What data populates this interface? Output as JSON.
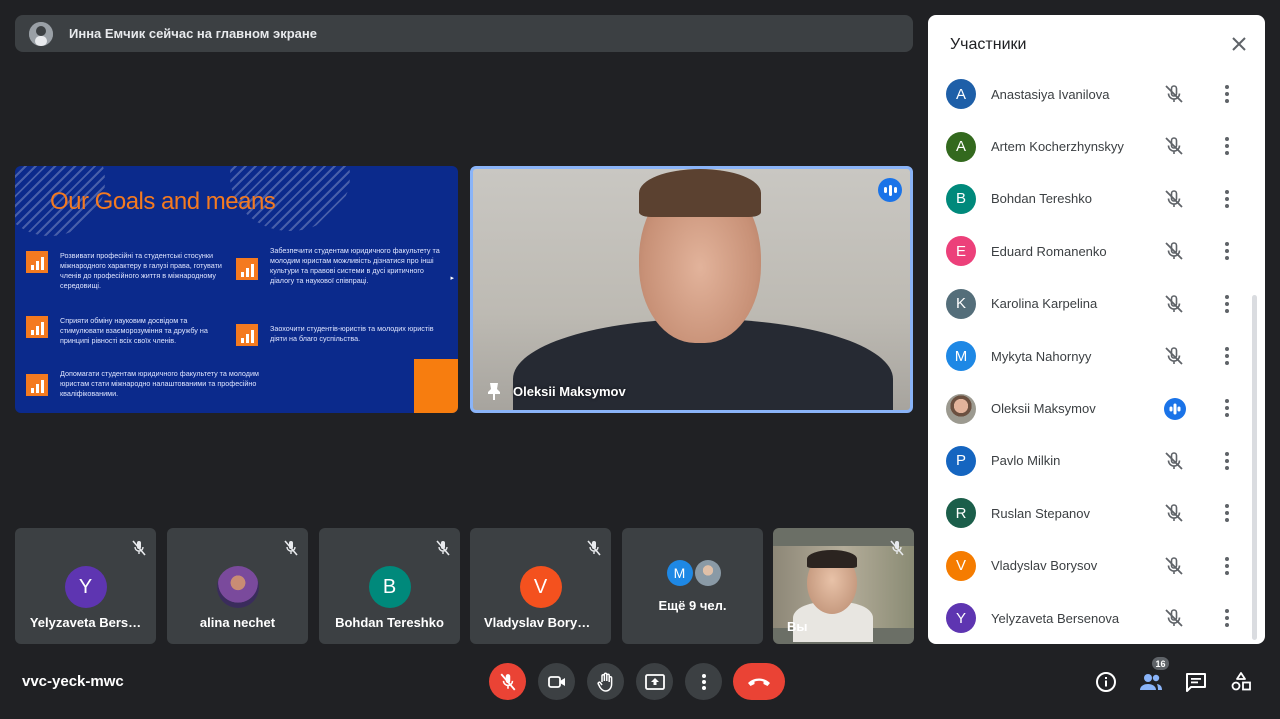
{
  "banner": {
    "text": "Инна Емчик сейчас на главном экране"
  },
  "slide": {
    "title": "Our Goals and means",
    "items": [
      "Розвивати професійні та студентські стосунки міжнародного характеру в галузі права, готувати членів до професійного життя в міжнародному середовищі.",
      "Забезпечити студентам юридичного факультету та молодим юристам можливість дізнатися про інші культури та правові системи в дусі критичного діалогу та наукової співпраці.",
      "Сприяти обміну науковим досвідом та стимулювати взаєморозуміння та дружбу на принципі рівності всіх своїх членів.",
      "Заохочити студентів-юристів та молодих юристів діяти на благо суспільства.",
      "Допомагати студентам юридичного факультету та молодим юристам стати міжнародно налаштованими та професійно кваліфікованими."
    ]
  },
  "speaker": {
    "name": "Oleksii Maksymov"
  },
  "tiles": [
    {
      "name": "Yelyzaveta Bers…",
      "initial": "Y",
      "color": "#5e35b1"
    },
    {
      "name": "alina nechet",
      "initial": "",
      "color": "#4a3a6e"
    },
    {
      "name": "Bohdan Tereshko",
      "initial": "B",
      "color": "#00897b"
    },
    {
      "name": "Vladyslav Borys…",
      "initial": "V",
      "color": "#f4511e"
    }
  ],
  "more_tile": {
    "initial": "M",
    "text": "Ещё 9 чел."
  },
  "self_tile": {
    "name": "Вы"
  },
  "panel": {
    "title": "Участники",
    "participants": [
      {
        "name": "Anastasiya Ivanilova",
        "initial": "A",
        "color": "#1e5fa8"
      },
      {
        "name": "Artem Kocherzhynskyy",
        "initial": "A",
        "color": "#33691e"
      },
      {
        "name": "Bohdan Tereshko",
        "initial": "B",
        "color": "#00897b"
      },
      {
        "name": "Eduard Romanenko",
        "initial": "E",
        "color": "#ec407a"
      },
      {
        "name": "Karolina Karpelina",
        "initial": "K",
        "color": "#546e7a"
      },
      {
        "name": "Mykyta Nahornyy",
        "initial": "M",
        "color": "#1e88e5"
      },
      {
        "name": "Oleksii Maksymov",
        "initial": "",
        "color": "#8d6e63"
      },
      {
        "name": "Pavlo Milkin",
        "initial": "P",
        "color": "#1565c0"
      },
      {
        "name": "Ruslan Stepanov",
        "initial": "R",
        "color": "#1b5e4a"
      },
      {
        "name": "Vladyslav Borysov",
        "initial": "V",
        "color": "#f57c00"
      },
      {
        "name": "Yelyzaveta Bersenova",
        "initial": "Y",
        "color": "#5e35b1"
      }
    ]
  },
  "bottom": {
    "meeting_code": "vvc-yeck-mwc",
    "participant_count": "16"
  }
}
